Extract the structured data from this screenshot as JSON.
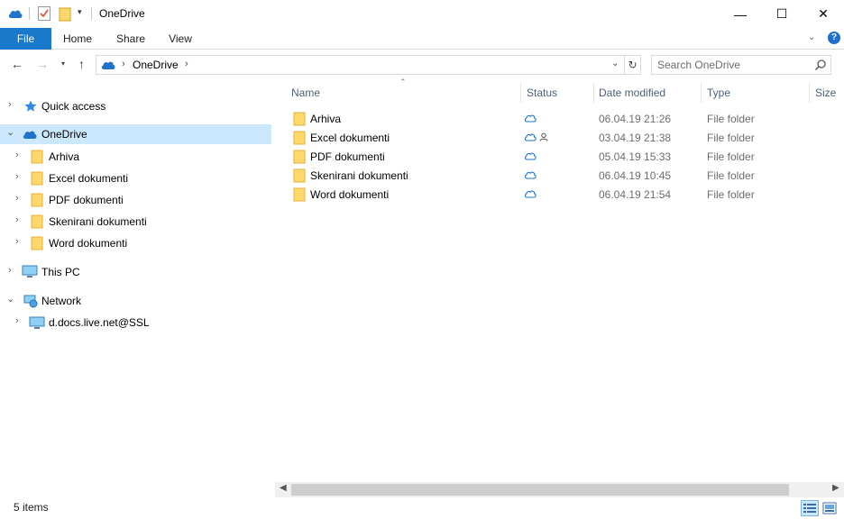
{
  "window": {
    "title": "OneDrive",
    "controls": {
      "minimize": "—",
      "maximize": "☐",
      "close": "✕"
    }
  },
  "ribbon": {
    "tabs": [
      {
        "label": "File",
        "active": true
      },
      {
        "label": "Home"
      },
      {
        "label": "Share"
      },
      {
        "label": "View"
      }
    ],
    "help": "?"
  },
  "address_bar": {
    "crumbs": [
      "OneDrive"
    ],
    "search_placeholder": "Search OneDrive"
  },
  "navigation_pane": {
    "items": [
      {
        "label": "Quick access",
        "icon": "star-icon"
      },
      {
        "label": "OneDrive",
        "icon": "onedrive-cloud-icon",
        "selected": true,
        "expanded": true
      },
      {
        "label": "Arhiva",
        "icon": "folder-icon"
      },
      {
        "label": "Excel dokumenti",
        "icon": "folder-icon"
      },
      {
        "label": "PDF dokumenti",
        "icon": "folder-icon"
      },
      {
        "label": "Skenirani dokumenti",
        "icon": "folder-icon"
      },
      {
        "label": "Word dokumenti",
        "icon": "folder-icon"
      },
      {
        "label": "This PC",
        "icon": "computer-icon"
      },
      {
        "label": "Network",
        "icon": "network-icon",
        "expanded": true
      },
      {
        "label": "d.docs.live.net@SSL",
        "icon": "network-drive-icon"
      }
    ]
  },
  "file_list": {
    "columns": [
      "Name",
      "Status",
      "Date modified",
      "Type",
      "Size"
    ],
    "rows": [
      {
        "name": "Arhiva",
        "status": "online-only",
        "date": "06.04.19 21:26",
        "type": "File folder"
      },
      {
        "name": "Excel dokumenti",
        "status": "online-only-shared",
        "date": "03.04.19 21:38",
        "type": "File folder"
      },
      {
        "name": "PDF dokumenti",
        "status": "online-only",
        "date": "05.04.19 15:33",
        "type": "File folder"
      },
      {
        "name": "Skenirani dokumenti",
        "status": "online-only",
        "date": "06.04.19 10:45",
        "type": "File folder"
      },
      {
        "name": "Word dokumenti",
        "status": "online-only",
        "date": "06.04.19 21:54",
        "type": "File folder"
      }
    ]
  },
  "status_bar": {
    "item_count": "5 items"
  },
  "colors": {
    "accent": "#1979ca",
    "selection": "#cce8ff",
    "folder": "#ffd86b",
    "cloud": "#1f74c8"
  }
}
